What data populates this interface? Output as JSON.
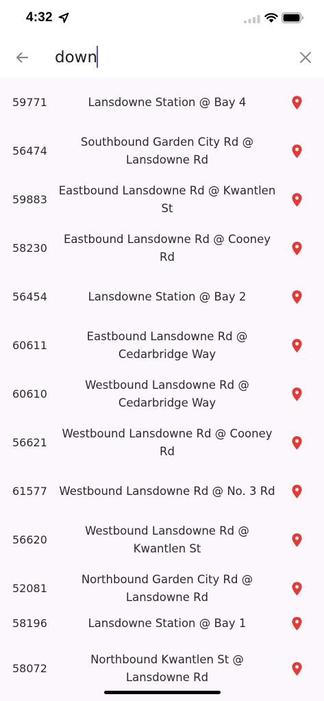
{
  "status_bar": {
    "time": "4:32",
    "icons": [
      "location-arrow-icon",
      "cellular-signal-icon",
      "wifi-icon",
      "battery-icon"
    ]
  },
  "search": {
    "back_icon": "arrow-left-icon",
    "query": "down",
    "clear_icon": "close-icon"
  },
  "colors": {
    "accent": "#5b4ec4",
    "list_background": "#fcf7fd",
    "pin": "#e53935"
  },
  "results": [
    {
      "stop_number": "59771",
      "name": "Lansdowne Station @ Bay 4",
      "icon": "map-pin-icon"
    },
    {
      "stop_number": "56474",
      "name": "Southbound Garden City Rd @ Lansdowne Rd",
      "icon": "map-pin-icon"
    },
    {
      "stop_number": "59883",
      "name": "Eastbound Lansdowne Rd @ Kwantlen St",
      "icon": "map-pin-icon"
    },
    {
      "stop_number": "58230",
      "name": "Eastbound Lansdowne Rd @ Cooney Rd",
      "icon": "map-pin-icon"
    },
    {
      "stop_number": "56454",
      "name": "Lansdowne Station @ Bay 2",
      "icon": "map-pin-icon"
    },
    {
      "stop_number": "60611",
      "name": "Eastbound Lansdowne Rd @ Cedarbridge Way",
      "icon": "map-pin-icon"
    },
    {
      "stop_number": "60610",
      "name": "Westbound Lansdowne Rd @ Cedarbridge Way",
      "icon": "map-pin-icon"
    },
    {
      "stop_number": "56621",
      "name": "Westbound Lansdowne Rd @ Cooney Rd",
      "icon": "map-pin-icon"
    },
    {
      "stop_number": "61577",
      "name": "Westbound Lansdowne Rd @ No. 3 Rd",
      "icon": "map-pin-icon"
    },
    {
      "stop_number": "56620",
      "name": "Westbound Lansdowne Rd @ Kwantlen St",
      "icon": "map-pin-icon"
    },
    {
      "stop_number": "52081",
      "name": "Northbound Garden City Rd @ Lansdowne Rd",
      "icon": "map-pin-icon"
    },
    {
      "stop_number": "58196",
      "name": "Lansdowne Station @ Bay 1",
      "icon": "map-pin-icon"
    },
    {
      "stop_number": "58072",
      "name": "Northbound Kwantlen St @ Lansdowne Rd",
      "icon": "map-pin-icon"
    }
  ]
}
